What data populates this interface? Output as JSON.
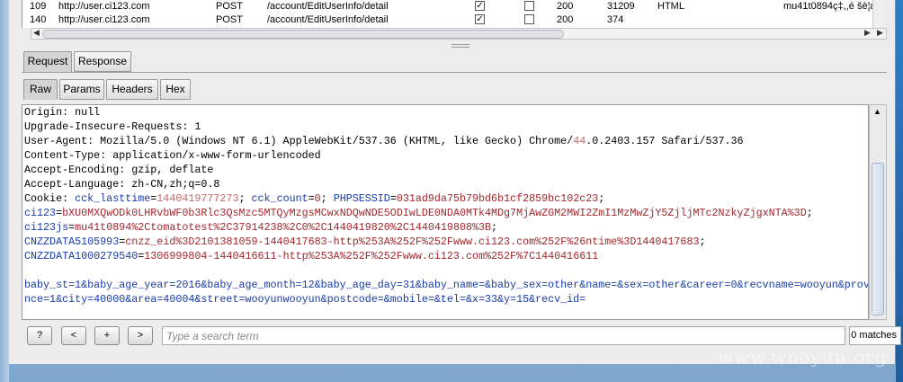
{
  "proxy_table": {
    "rows": [
      {
        "num": "109",
        "host": "http://user.ci123.com",
        "method": "POST",
        "url": "/account/EditUserInfo/detail",
        "edited": "✓",
        "status": "200",
        "length": "31209",
        "mime": "HTML",
        "extra": "mu41t0894ç‡,,é  šè¦æ"
      },
      {
        "num": "140",
        "host": "http://user.ci123.com",
        "method": "POST",
        "url": "/account/EditUserInfo/detail",
        "edited": "✓",
        "status": "200",
        "length": "374",
        "mime": "",
        "extra": ""
      }
    ]
  },
  "tabs": {
    "request": "Request",
    "response": "Response"
  },
  "subtabs": {
    "raw": "Raw",
    "params": "Params",
    "headers": "Headers",
    "hex": "Hex"
  },
  "request": {
    "origin": "Origin: null",
    "upgrade": "Upgrade-Insecure-Requests: 1",
    "user_agent_a": "User-Agent: Mozilla/5.0 (Windows NT 6.1) AppleWebKit/537.36 (KHTML, like Gecko) Chrome/",
    "user_agent_v": "44",
    "user_agent_b": ".0.2403.157 Safari/537.36",
    "content_type": "Content-Type: application/x-www-form-urlencoded",
    "accept_encoding": "Accept-Encoding: gzip, deflate",
    "accept_language": "Accept-Language: zh-CN,zh;q=0.8",
    "cookie": {
      "label": "Cookie: ",
      "k1": "cck_lasttime",
      "v1": "1440419777273",
      "k2": "cck_count",
      "v2": "0",
      "k3": "PHPSESSID",
      "v3": "031ad9da75b79bd6b1cf2859bc102c23",
      "k4": "ci123",
      "v4": "bXU0MXQwODk0LHRvbWF0b3Rlc3QsMzc5MTQyMzgsMCwxNDQwNDE5ODIwLDE0NDA0MTk4MDg7MjAwZGM2MWI2ZmI1MzMwZjY5ZjljMTc2NzkyZjgxNTA%3D",
      "k5": "ci123js",
      "v5": "mu41t0894%2Ctomatotest%2C37914238%2C0%2C1440419820%2C1440419808%3B",
      "k6": "CNZZDATA5105993",
      "v6": "cnzz_eid%3D2101381059-1440417683-http%253A%252F%252Fwww.ci123.com%252F%26ntime%3D1440417683",
      "k7": "CNZZDATA1000279540",
      "v7": "1306999804-1440416611-http%253A%252F%252Fwww.ci123.com%252F%7C1440416611"
    },
    "body_line1": "baby_st=1&baby_age_year=2016&baby_age_month=12&baby_age_day=31&baby_name=&baby_sex=other&name=&sex=other&career=0&recvname=wooyun&provi",
    "body_line2": "nce=1&city=40000&area=40004&street=wooyunwooyun&postcode=&mobile=&tel=&x=33&y=15&recv_id="
  },
  "search": {
    "help_label": "?",
    "prev_label": "<",
    "add_label": "+",
    "next_label": ">",
    "placeholder": "Type a search term",
    "matches": "0 matches"
  },
  "watermark": "www.wooyun.org"
}
